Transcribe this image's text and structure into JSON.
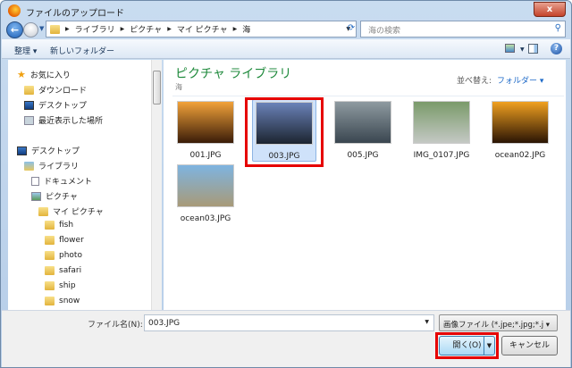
{
  "window": {
    "title": "ファイルのアップロード",
    "close": "x"
  },
  "address": {
    "segments": [
      "ライブラリ",
      "ピクチャ",
      "マイ ピクチャ",
      "海"
    ],
    "search_placeholder": "海の検索"
  },
  "toolbar": {
    "organize": "整理 ▾",
    "new_folder": "新しいフォルダー"
  },
  "nav": {
    "favorites": "お気に入り",
    "fav_items": [
      "ダウンロード",
      "デスクトップ",
      "最近表示した場所"
    ],
    "desktop": "デスクトップ",
    "libraries": "ライブラリ",
    "documents": "ドキュメント",
    "pictures": "ピクチャ",
    "my_pictures": "マイ ピクチャ",
    "folders": [
      "fish",
      "flower",
      "photo",
      "safari",
      "ship",
      "snow"
    ]
  },
  "content": {
    "title": "ピクチャ ライブラリ",
    "subtitle": "海",
    "sort_label": "並べ替え:",
    "sort_value": "フォルダー ▾",
    "files": [
      {
        "name": "001.JPG",
        "colors": [
          "#f2a23a",
          "#3a1c08"
        ]
      },
      {
        "name": "003.JPG",
        "colors": [
          "#6a82b8",
          "#1c2430"
        ],
        "selected": true
      },
      {
        "name": "005.JPG",
        "colors": [
          "#8e9aa0",
          "#3a4650"
        ]
      },
      {
        "name": "IMG_0107.JPG",
        "colors": [
          "#7a9a6a",
          "#c4c8c4"
        ]
      },
      {
        "name": "ocean02.JPG",
        "colors": [
          "#f0a020",
          "#2a1404"
        ]
      },
      {
        "name": "ocean03.JPG",
        "colors": [
          "#7eb4e0",
          "#a89a78"
        ]
      }
    ]
  },
  "bottom": {
    "filename_label": "ファイル名(N):",
    "filename_value": "003.JPG",
    "filetype": "画像ファイル (*.jpe;*.jpg;*.j",
    "open": "開く(O)",
    "cancel": "キャンセル"
  }
}
